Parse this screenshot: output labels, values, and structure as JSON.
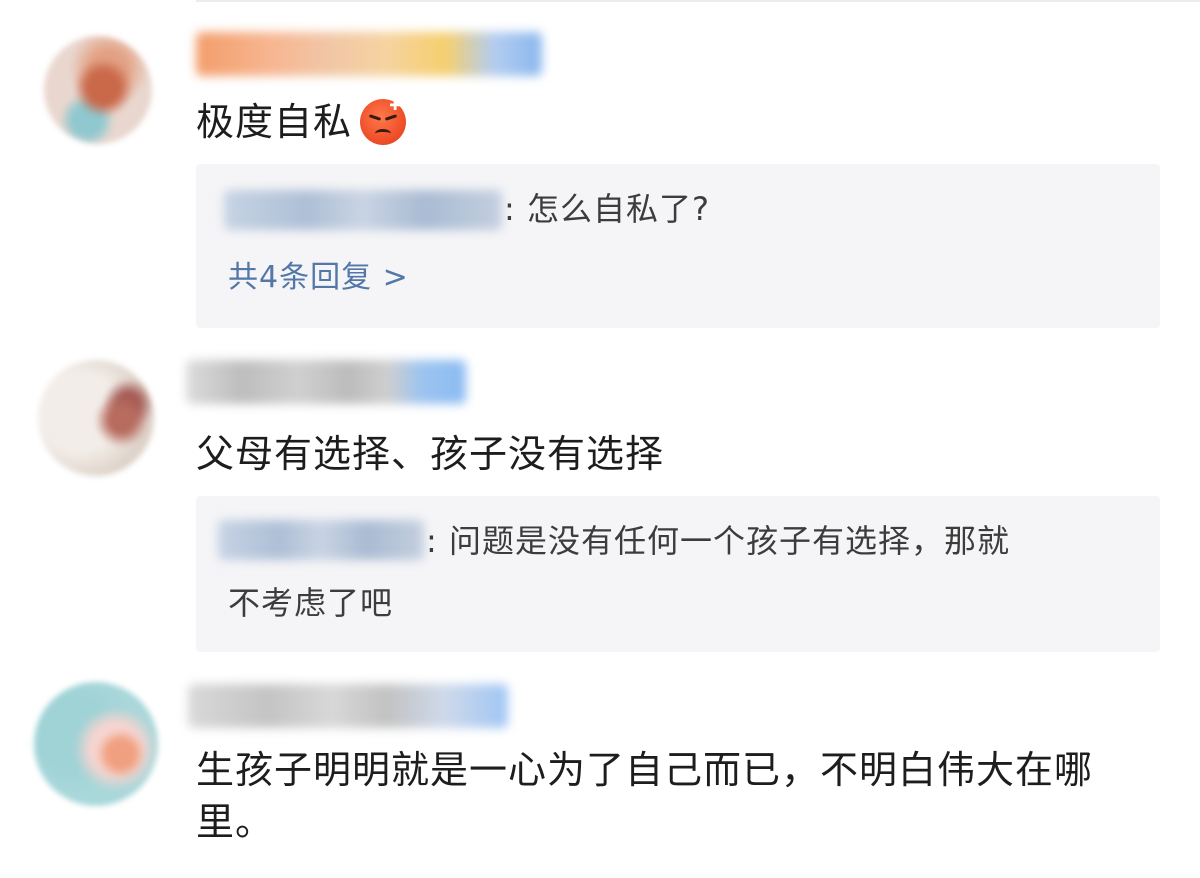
{
  "comments": [
    {
      "text": "极度自私",
      "emoji": "angry-face-emoji",
      "reply": {
        "text": ": 怎么自私了?",
        "more_replies": "共4条回复 >"
      }
    },
    {
      "text": "父母有选择、孩子没有选择",
      "reply": {
        "text_line1": ": 问题是没有任何一个孩子有选择，那就",
        "text_line2": "不考虑了吧"
      }
    },
    {
      "text": "生孩子明明就是一心为了自己而已，不明白伟大在哪里。"
    }
  ],
  "colors": {
    "reply_link": "#5277a8",
    "reply_background": "#f5f5f7",
    "text_primary": "#1d1d1d"
  }
}
